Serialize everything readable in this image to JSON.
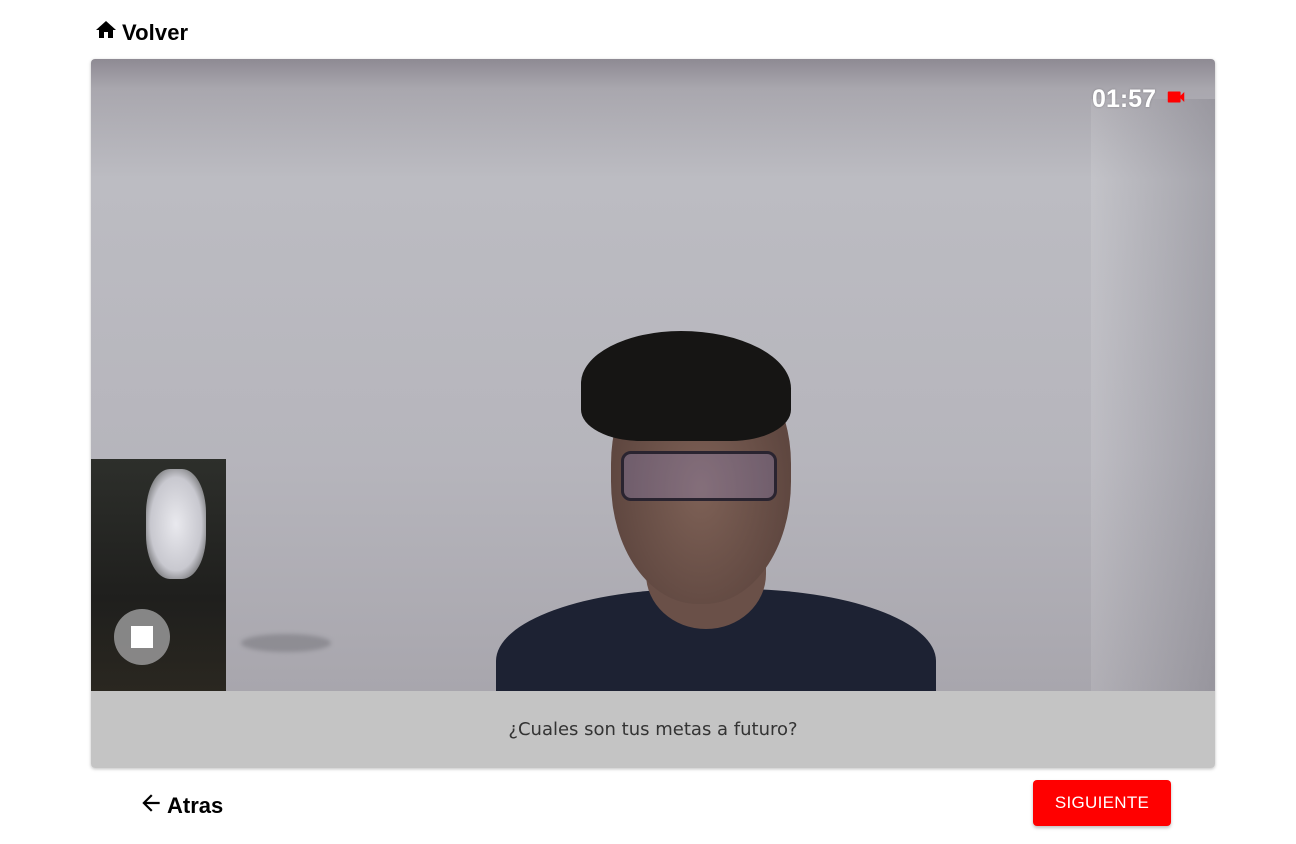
{
  "nav": {
    "home_label": "Volver",
    "home_icon": "home-icon",
    "back_label": "Atras",
    "back_icon": "arrow-left-icon"
  },
  "recorder": {
    "elapsed_time": "01:57",
    "recording_icon": "video-camera-icon",
    "recording_color": "#ff0000",
    "stop_icon": "stop-icon"
  },
  "question": {
    "text": "¿Cuales son tus metas a futuro?"
  },
  "actions": {
    "next_label": "SIGUIENTE",
    "next_color": "#ff0000"
  }
}
